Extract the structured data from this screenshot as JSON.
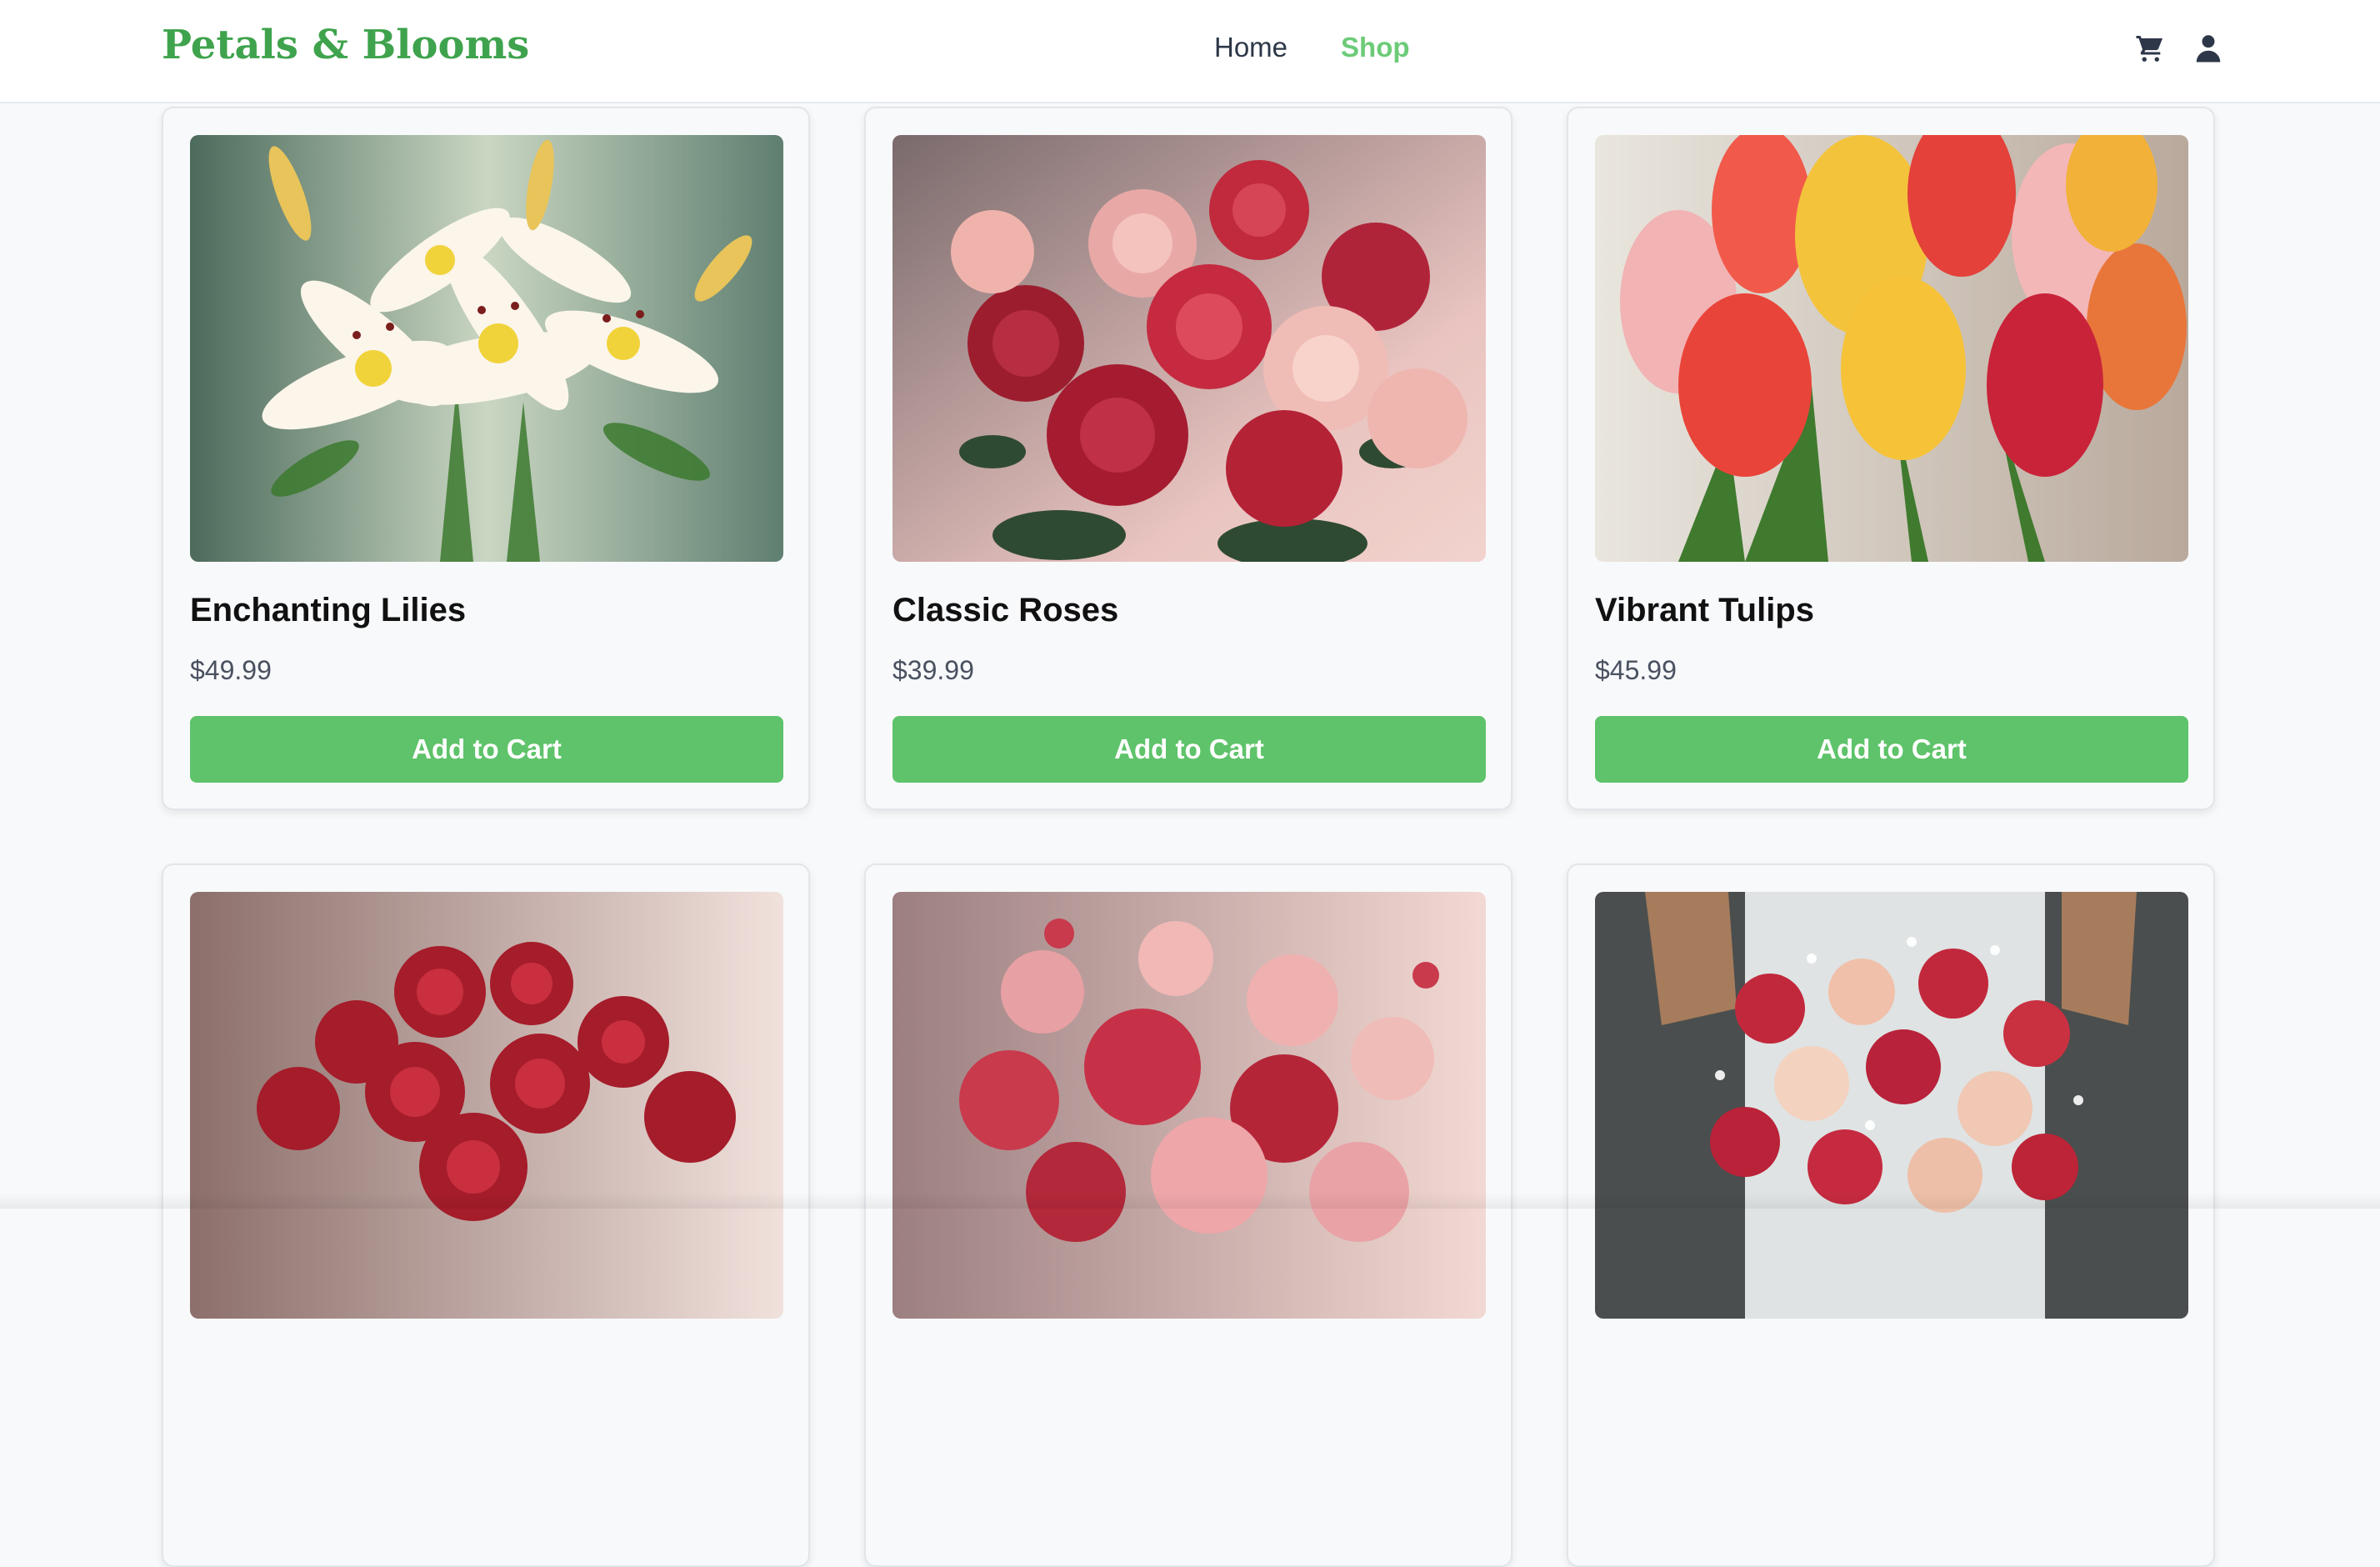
{
  "brand": {
    "name": "Petals & Blooms",
    "color": "#3fa34d"
  },
  "nav": {
    "items": [
      {
        "label": "Home",
        "active": false
      },
      {
        "label": "Shop",
        "active": true
      }
    ],
    "active_color": "#6ccb78"
  },
  "header_icons": [
    "cart-icon",
    "user-icon"
  ],
  "products": [
    {
      "name": "Enchanting Lilies",
      "price": "$49.99",
      "button": "Add to Cart",
      "image": "white and pink lily bouquet"
    },
    {
      "name": "Classic Roses",
      "price": "$39.99",
      "button": "Add to Cart",
      "image": "red and pink rose bouquet"
    },
    {
      "name": "Vibrant Tulips",
      "price": "$45.99",
      "button": "Add to Cart",
      "image": "red and yellow tulip bouquet"
    },
    {
      "name": "",
      "price": "",
      "button": "",
      "image": "red rose dome bouquet"
    },
    {
      "name": "",
      "price": "",
      "button": "",
      "image": "pink and red rose bouquet"
    },
    {
      "name": "",
      "price": "",
      "button": "",
      "image": "bridal bouquet held by bride"
    }
  ],
  "accent_button_color": "#5ec36a"
}
